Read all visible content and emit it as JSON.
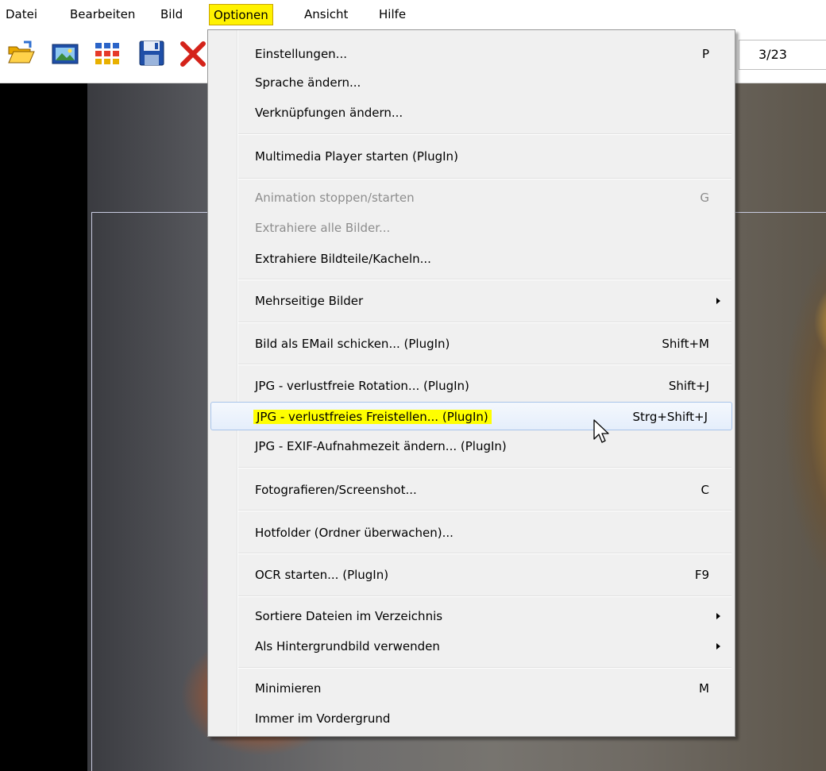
{
  "menubar": {
    "items": [
      {
        "label": "Datei"
      },
      {
        "label": "Bearbeiten"
      },
      {
        "label": "Bild"
      },
      {
        "label": "Optionen"
      },
      {
        "label": "Ansicht"
      },
      {
        "label": "Hilfe"
      }
    ]
  },
  "toolbar": {
    "buttons": [
      "open-folder-icon",
      "slideshow-icon",
      "thumbnails-icon",
      "save-icon",
      "delete-icon"
    ],
    "counter": "3/23"
  },
  "menu": {
    "items": [
      {
        "label": "Einstellungen...",
        "shortcut": "P"
      },
      {
        "label": "Sprache ändern..."
      },
      {
        "label": "Verknüpfungen ändern..."
      },
      {
        "label": "Multimedia Player starten (PlugIn)"
      },
      {
        "label": "Animation stoppen/starten",
        "shortcut": "G",
        "disabled": true
      },
      {
        "label": "Extrahiere alle Bilder...",
        "disabled": true
      },
      {
        "label": "Extrahiere Bildteile/Kacheln..."
      },
      {
        "label": "Mehrseitige Bilder",
        "submenu": true
      },
      {
        "label": "Bild als EMail schicken... (PlugIn)",
        "shortcut": "Shift+M"
      },
      {
        "label": "JPG - verlustfreie Rotation... (PlugIn)",
        "shortcut": "Shift+J"
      },
      {
        "label": "JPG - verlustfreies Freistellen... (PlugIn)",
        "shortcut": "Strg+Shift+J",
        "highlighted": true
      },
      {
        "label": "JPG - EXIF-Aufnahmezeit ändern... (PlugIn)"
      },
      {
        "label": "Fotografieren/Screenshot...",
        "shortcut": "C"
      },
      {
        "label": "Hotfolder (Ordner überwachen)..."
      },
      {
        "label": "OCR starten... (PlugIn)",
        "shortcut": "F9"
      },
      {
        "label": "Sortiere Dateien im Verzeichnis",
        "submenu": true
      },
      {
        "label": "Als Hintergrundbild verwenden",
        "submenu": true
      },
      {
        "label": "Minimieren",
        "shortcut": "M"
      },
      {
        "label": "Immer im Vordergrund"
      }
    ]
  },
  "colors": {
    "highlight": "#ffff00",
    "menu_bg": "#f0f0f0",
    "disabled_text": "#8d8d8d"
  }
}
